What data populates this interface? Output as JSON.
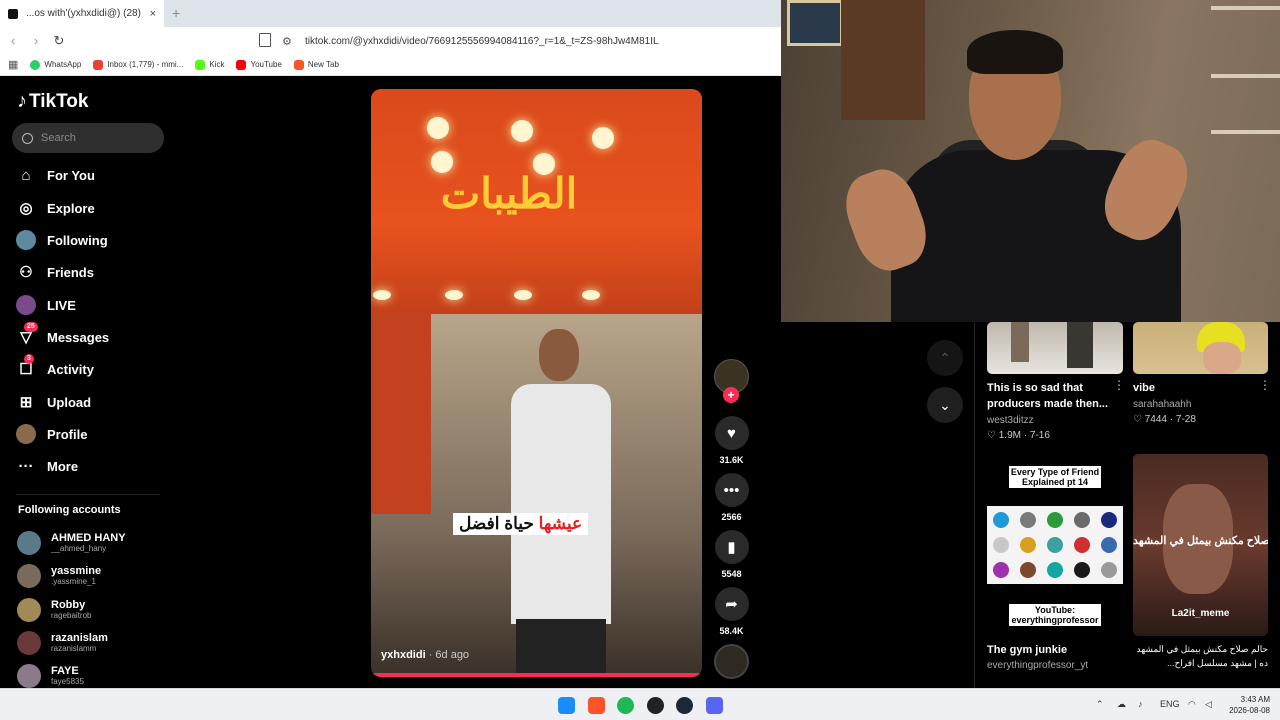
{
  "browser": {
    "tab_title": "...os with'(yxhxdidi@) الطيبات (28)",
    "tab_close": "×",
    "new_tab": "+",
    "url": "tiktok.com/@yxhxdidi/video/7669125556994084116?_r=1&_t=ZS-98hJw4M81IL",
    "bookmarks": [
      {
        "label": "WhatsApp",
        "color": "#25d366"
      },
      {
        "label": "Inbox (1,779) - mmi...",
        "color": "#ea4335"
      },
      {
        "label": "Kick",
        "color": "#53fc18"
      },
      {
        "label": "YouTube",
        "color": "#ff0000"
      },
      {
        "label": "New Tab",
        "color": "#fb542b"
      }
    ]
  },
  "tiktok": {
    "logo": "TikTok",
    "search_placeholder": "Search",
    "menu": [
      {
        "label": "For You",
        "icon": "home-icon"
      },
      {
        "label": "Explore",
        "icon": "compass-icon"
      },
      {
        "label": "Following",
        "icon": "avatar"
      },
      {
        "label": "Friends",
        "icon": "friends-icon"
      },
      {
        "label": "LIVE",
        "icon": "live-icon"
      },
      {
        "label": "Messages",
        "icon": "messages-icon",
        "badge": "25"
      },
      {
        "label": "Activity",
        "icon": "activity-icon",
        "badge": "3"
      },
      {
        "label": "Upload",
        "icon": "upload-icon"
      },
      {
        "label": "Profile",
        "icon": "avatar"
      },
      {
        "label": "More",
        "icon": "more-icon"
      }
    ],
    "following_title": "Following accounts",
    "following": [
      {
        "name": "AHMED HANY",
        "user": "__ahmed_hany"
      },
      {
        "name": "yassmine",
        "user": ".yassmine_1"
      },
      {
        "name": "Robby",
        "user": "ragebaitrob"
      },
      {
        "name": "razanislam",
        "user": "razanislamm"
      },
      {
        "name": "FAYE",
        "user": "faye5835"
      }
    ]
  },
  "video": {
    "sign": "الطيبات",
    "caption_white": "حياة افضل",
    "caption_red": "عيشها",
    "author": "yxhxdidi",
    "ago": "· 6d ago",
    "likes": "31.6K",
    "comments": "2566",
    "saves": "5548",
    "shares": "58.4K"
  },
  "grid": [
    {
      "title": "This is so sad that producers made then...",
      "user": "west3ditzz",
      "stats": "♡ 1.9M · 7-16"
    },
    {
      "title": "vibe",
      "user": "sarahahaahh",
      "stats": "♡ 7444 · 7-28"
    },
    {
      "title": "The gym junkie",
      "user": "everythingprofessor_yt",
      "stats": "",
      "thumb_title": "Every Type of Friend Explained pt 14",
      "thumb_footer": "YouTube: everythingprofessor"
    },
    {
      "title": "حالم صلاح مكنش بيمثل في المشهد ده | مشهد مسلسل افراح...",
      "user": "",
      "stats": "",
      "thumb_text": "صلاح مكنش بيمثل في المشهد",
      "thumb_footer": "La2it_meme"
    }
  ],
  "taskbar": {
    "lang": "ENG",
    "time": "3:43 AM",
    "date": "2026-08-08"
  }
}
